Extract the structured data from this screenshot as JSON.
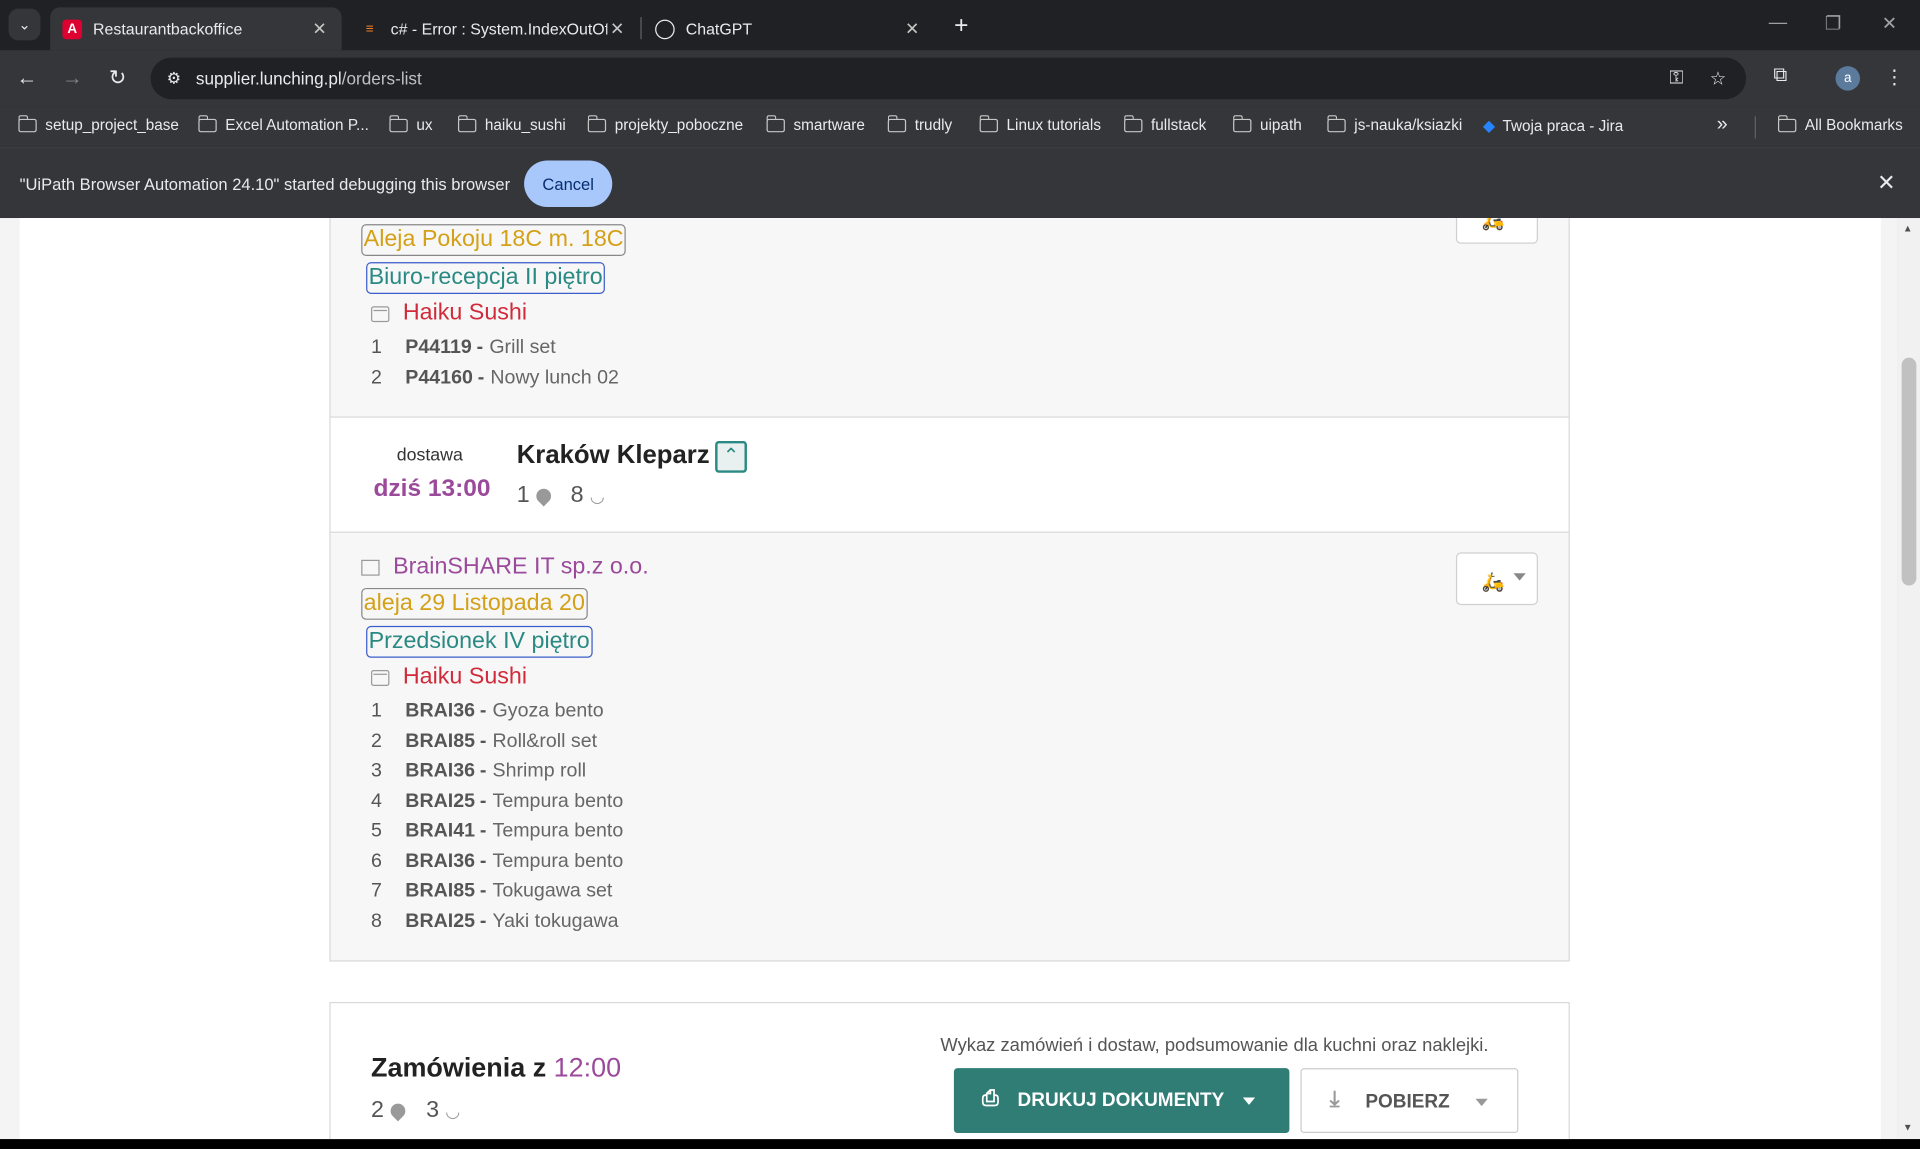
{
  "browser": {
    "tabs": [
      {
        "title": "Restaurantbackoffice"
      },
      {
        "title": "c# - Error : System.IndexOutOfRa"
      },
      {
        "title": "ChatGPT"
      }
    ],
    "url_host": "supplier.lunching.pl",
    "url_path": "/orders-list",
    "avatar_letter": "a",
    "bookmarks": [
      "setup_project_base",
      "Excel Automation P...",
      "ux",
      "haiku_sushi",
      "projekty_poboczne",
      "smartware",
      "trudly",
      "Linux tutorials",
      "fullstack",
      "uipath",
      "js-nauka/ksiazki",
      "Twoja praca - Jira"
    ],
    "all_bookmarks": "All Bookmarks",
    "infobar_text": "\"UiPath Browser Automation 24.10\" started debugging this browser",
    "infobar_cancel": "Cancel"
  },
  "order1": {
    "address": "Aleja Pokoju 18C m. 18C",
    "place": "Biuro-recepcja II piętro",
    "restaurant": "Haiku Sushi",
    "items": [
      {
        "n": "1",
        "code": "P44119",
        "name": "Grill set"
      },
      {
        "n": "2",
        "code": "P44160",
        "name": "Nowy lunch 02"
      }
    ]
  },
  "delivery": {
    "label": "dostawa",
    "time": "dziś 13:00",
    "city": "Kraków Kleparz",
    "locations": "1",
    "meals": "8"
  },
  "order2": {
    "company": "BrainSHARE IT sp.z o.o.",
    "address": "aleja 29 Listopada 20",
    "place": "Przedsionek IV piętro",
    "restaurant": "Haiku Sushi",
    "items": [
      {
        "n": "1",
        "code": "BRAI36",
        "name": "Gyoza bento"
      },
      {
        "n": "2",
        "code": "BRAI85",
        "name": "Roll&roll set"
      },
      {
        "n": "3",
        "code": "BRAI36",
        "name": "Shrimp roll"
      },
      {
        "n": "4",
        "code": "BRAI25",
        "name": "Tempura bento"
      },
      {
        "n": "5",
        "code": "BRAI41",
        "name": "Tempura bento"
      },
      {
        "n": "6",
        "code": "BRAI36",
        "name": "Tempura bento"
      },
      {
        "n": "7",
        "code": "BRAI85",
        "name": "Tokugawa set"
      },
      {
        "n": "8",
        "code": "BRAI25",
        "name": "Yaki tokugawa"
      }
    ]
  },
  "orders_section": {
    "title_prefix": "Zamówienia z",
    "title_time": "12:00",
    "locations": "2",
    "meals": "3",
    "summary_text": "Wykaz zamówień i dostaw, podsumowanie dla kuchni oraz naklejki.",
    "print_label": "DRUKUJ DOKUMENTY",
    "download_label": "POBIERZ"
  }
}
